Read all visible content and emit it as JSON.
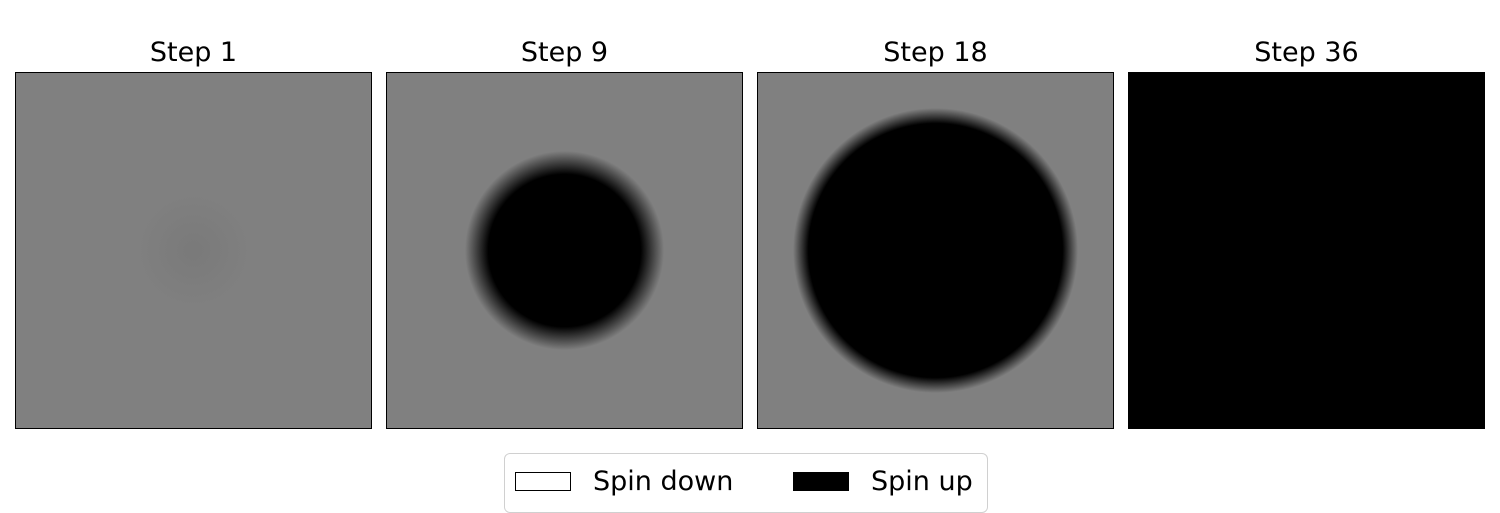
{
  "chart_data": {
    "type": "heatmap",
    "description_colormap": {
      "min_color": "#ffffff",
      "max_color": "#000000"
    },
    "panels": [
      {
        "title": "Step 1",
        "background": "#808080",
        "blob": {
          "shade": "#7a7a7a",
          "radius_fraction": 0.17,
          "edge_softness": 0.9
        }
      },
      {
        "title": "Step 9",
        "background": "#808080",
        "blob": {
          "shade": "#000000",
          "radius_fraction": 0.37,
          "edge_softness": 0.18
        }
      },
      {
        "title": "Step 18",
        "background": "#808080",
        "blob": {
          "shade": "#000000",
          "radius_fraction": 0.55,
          "edge_softness": 0.08
        }
      },
      {
        "title": "Step 36",
        "background": "#000000",
        "blob": null
      }
    ],
    "legend": {
      "placement": "bottom-center",
      "entries": [
        {
          "label": "Spin down",
          "color": "#ffffff"
        },
        {
          "label": "Spin up",
          "color": "#000000"
        }
      ]
    }
  }
}
